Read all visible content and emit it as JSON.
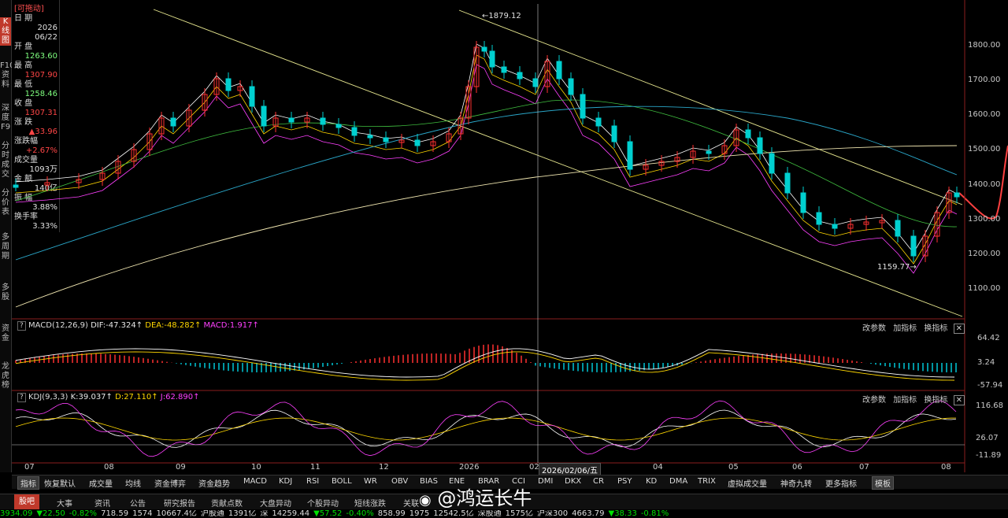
{
  "left_tabs": [
    {
      "label": "K线图",
      "active": true
    },
    {
      "label": "F10资料"
    },
    {
      "label": "深度F9"
    },
    {
      "label": "分时成交"
    },
    {
      "label": "分价表"
    },
    {
      "label": "多周期"
    },
    {
      "label": "多股"
    },
    {
      "label": "资金"
    },
    {
      "label": "龙虎榜"
    }
  ],
  "info_panel": {
    "title": "[可拖动]",
    "date_label": "日 期",
    "year": "2026",
    "date": "06/22",
    "open_label": "开 盘",
    "open": "1263.60",
    "high_label": "最 高",
    "high": "1307.90",
    "low_label": "最 低",
    "low": "1258.46",
    "close_label": "收 盘",
    "close": "1307.31",
    "change_label": "涨 跌",
    "change": "▲33.96",
    "pct_label": "涨跌幅",
    "pct": "+2.67%",
    "volume_label": "成交量",
    "volume": "1093万",
    "amount_label": "金 额",
    "amount": "140亿",
    "amplitude_label": "振 幅",
    "amplitude": "3.88%",
    "turnover_label": "换手率",
    "turnover": "3.33%"
  },
  "main_chart": {
    "price_axis": [
      "1800.00",
      "1700.00",
      "1600.00",
      "1500.00",
      "1400.00",
      "1300.00",
      "1200.00",
      "1100.00"
    ],
    "high_annotation": "1879.12",
    "low_annotation": "1159.77",
    "cursor_date": "2026/02/06/五"
  },
  "macd_panel": {
    "question": "?",
    "name": "MACD(12,26,9)",
    "dif": "DIF:-47.324",
    "dea": "DEA:-48.282",
    "macd": "MACD:1.917",
    "axis": [
      "64.42",
      "3.24",
      "-57.94"
    ],
    "links": [
      "改参数",
      "加指标",
      "换指标"
    ]
  },
  "kdj_panel": {
    "question": "?",
    "name": "KDJ(9,3,3)",
    "k": "K:39.037",
    "d": "D:27.110",
    "j": "J:62.890",
    "axis": [
      "116.68",
      "26.07",
      "-11.89"
    ],
    "links": [
      "改参数",
      "加指标",
      "换指标"
    ]
  },
  "x_axis": [
    "07",
    "08",
    "09",
    "10",
    "11",
    "12",
    "2026",
    "02",
    "04",
    "05",
    "06",
    "07",
    "08"
  ],
  "indicator_bar": [
    "指标",
    "恢复默认",
    "成交量",
    "均线",
    "资金博弈",
    "资金趋势",
    "MACD",
    "KDJ",
    "RSI",
    "BOLL",
    "WR",
    "OBV",
    "BIAS",
    "ENE",
    "BRAR",
    "CCI",
    "DMI",
    "DKX",
    "CR",
    "PSY",
    "KD",
    "DMA",
    "TRIX",
    "虚拟成交量",
    "神奇九转",
    "更多指标",
    "模板"
  ],
  "bottom_tabs": [
    "股吧",
    "大事",
    "资讯",
    "公告",
    "研究报告",
    "贡献点数",
    "大盘异动",
    "个股异动",
    "短线涨跌",
    "关联"
  ],
  "watermark": "@鸿运长牛",
  "ticker": [
    "3934.09",
    "▼22.50",
    "-0.82%",
    "718.59",
    "1574",
    "10667.4亿",
    "沪股通",
    "1391亿",
    "深",
    "14259.44",
    "▼57.52",
    "-0.40%",
    "858.99",
    "1975",
    "12542.5亿",
    "深股通",
    "1575亿",
    "沪深300",
    "4663.79",
    "▼38.33",
    "-0.81%"
  ],
  "colors": {
    "up": "#ff4646",
    "down": "#00d4d4",
    "accent_red": "#c0392b"
  }
}
